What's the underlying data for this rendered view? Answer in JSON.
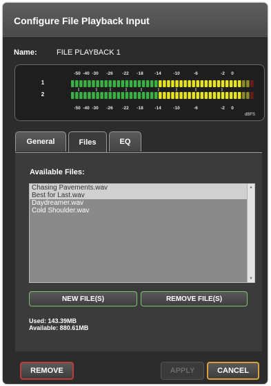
{
  "dialog": {
    "title": "Configure File Playback Input",
    "name_label": "Name:",
    "name_value": "FILE PLAYBACK 1"
  },
  "meter": {
    "channels": [
      "1",
      "2"
    ],
    "scale_labels": [
      "-50",
      "-40",
      "-30",
      "-26",
      "-22",
      "-18",
      "-14",
      "-10",
      "-6",
      "-2",
      "0"
    ],
    "unit": "dBFS",
    "colors": {
      "low": "#3cb043",
      "mid": "#e8e31f",
      "high": "#8b8b2a",
      "clip": "#6a1a1a"
    }
  },
  "tabs": [
    {
      "label": "General",
      "active": false
    },
    {
      "label": "Files",
      "active": true
    },
    {
      "label": "EQ",
      "active": false
    }
  ],
  "files": {
    "heading": "Available Files:",
    "items": [
      {
        "name": "Chasing Pavements.wav",
        "selected": true
      },
      {
        "name": "Best for Last.wav",
        "selected": true
      },
      {
        "name": "Daydreamer.wav",
        "selected": false
      },
      {
        "name": "Cold Shoulder.wav",
        "selected": false
      }
    ],
    "new_label": "NEW FILE(S)",
    "remove_label": "REMOVE FILE(S)",
    "used": "Used: 143.39MB",
    "available": "Available: 880.61MB"
  },
  "footer": {
    "remove_label": "REMOVE",
    "apply_label": "APPLY",
    "cancel_label": "CANCEL"
  }
}
